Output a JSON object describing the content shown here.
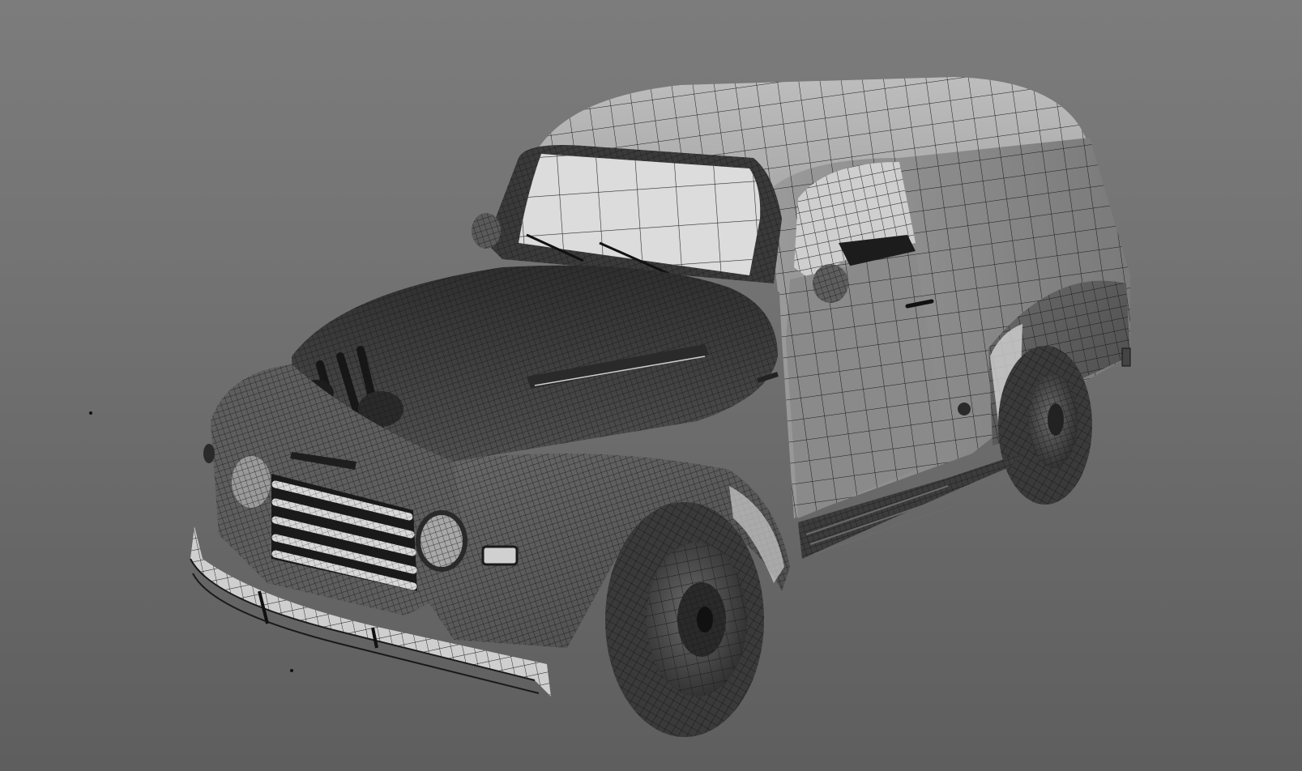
{
  "scene": {
    "subject": "wireframe-vintage-panel-van",
    "render_mode": "wireframe-shaded",
    "colors": {
      "background_top": "#7c7c7c",
      "background_bottom": "#5e5e5e",
      "body_shade": "#4f4f4f",
      "body_dark": "#2e2e2e",
      "glass": "#d9d9d9",
      "wire": "#1a1a1a",
      "chrome": "#cfcfcf",
      "tire": "#3a3a3a"
    }
  }
}
